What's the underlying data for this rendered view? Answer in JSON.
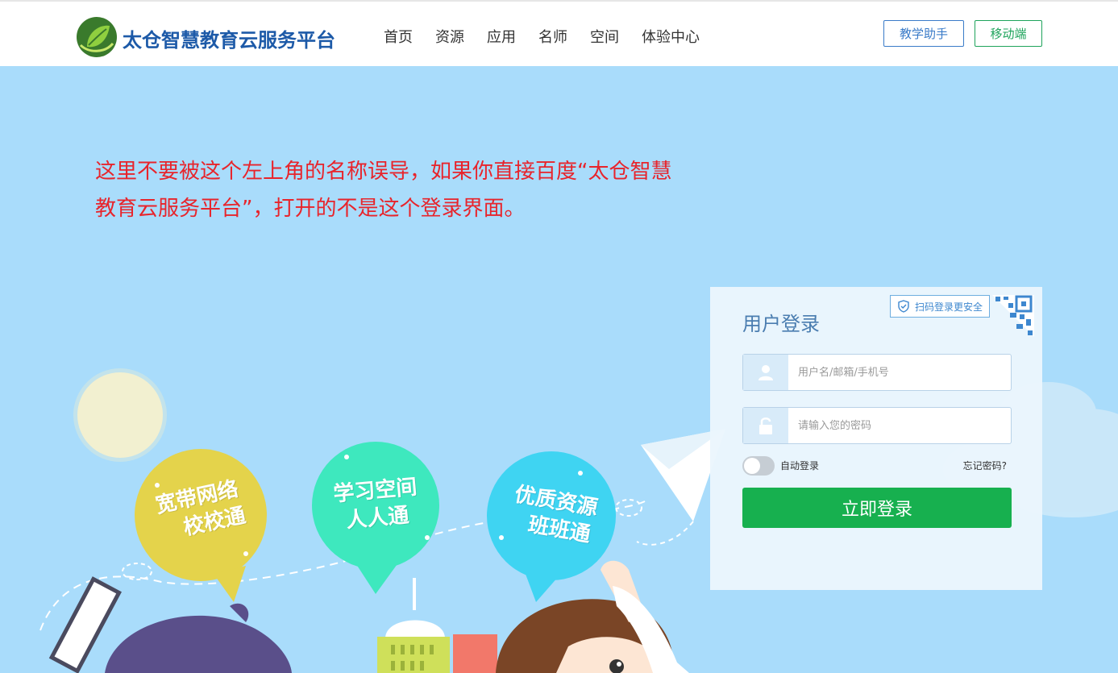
{
  "header": {
    "logo_text": "太仓智慧教育云服务平台",
    "nav": [
      "首页",
      "资源",
      "应用",
      "名师",
      "空间",
      "体验中心"
    ],
    "teach_btn": "教学助手",
    "mobile_btn": "移动端"
  },
  "note": {
    "text": "这里不要被这个左上角的名称误导，如果你直接百度“太仓智慧教育云服务平台”，打开的不是这个登录界面。"
  },
  "bubbles": [
    {
      "line1": "宽带网络",
      "line2": "校校通",
      "color": "#e4d34b"
    },
    {
      "line1": "学习空间",
      "line2": "人人通",
      "color": "#3ee8be"
    },
    {
      "line1": "优质资源",
      "line2": "班班通",
      "color": "#3fd4f2"
    }
  ],
  "login": {
    "title": "用户登录",
    "qr_tip": "扫码登录更安全",
    "username_placeholder": "用户名/邮箱/手机号",
    "password_placeholder": "请输入您的密码",
    "auto_login": "自动登录",
    "forgot": "忘记密码?",
    "submit": "立即登录"
  },
  "colors": {
    "background": "#a9dcfb",
    "brand_blue": "#1d5aa8",
    "accent_green": "#17b04f",
    "note_red": "#e8242b"
  },
  "icons": {
    "user": "user-icon",
    "lock": "lock-icon",
    "shield": "shield-icon",
    "qr": "qr-code-icon"
  }
}
